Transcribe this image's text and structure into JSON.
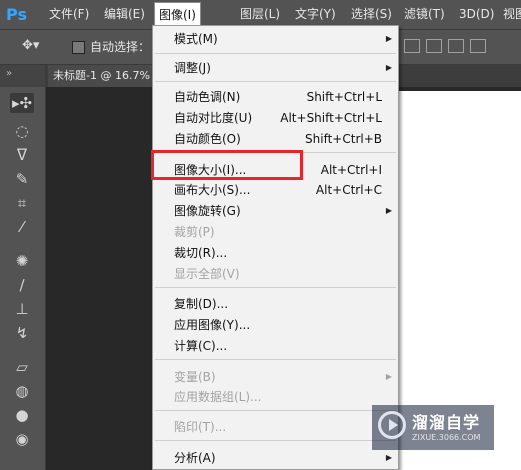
{
  "app": {
    "logo": "Ps"
  },
  "menubar": {
    "items": [
      {
        "label": "文件(F)"
      },
      {
        "label": "编辑(E)"
      },
      {
        "label": "图像(I)"
      },
      {
        "label": "图层(L)"
      },
      {
        "label": "文字(Y)"
      },
      {
        "label": "选择(S)"
      },
      {
        "label": "滤镜(T)"
      },
      {
        "label": "3D(D)"
      },
      {
        "label": "视图("
      }
    ]
  },
  "options_bar": {
    "auto_select_label": "自动选择：",
    "move_tool_icon": "move-icon"
  },
  "document_tab": {
    "title": "未标题-1 @ 16.7%"
  },
  "image_menu": {
    "items": [
      {
        "label": "模式(M)",
        "submenu": true
      },
      {
        "label": "调整(J)",
        "submenu": true
      },
      {
        "label": "自动色调(N)",
        "shortcut": "Shift+Ctrl+L"
      },
      {
        "label": "自动对比度(U)",
        "shortcut": "Alt+Shift+Ctrl+L"
      },
      {
        "label": "自动颜色(O)",
        "shortcut": "Shift+Ctrl+B"
      },
      {
        "label": "图像大小(I)...",
        "shortcut": "Alt+Ctrl+I"
      },
      {
        "label": "画布大小(S)...",
        "shortcut": "Alt+Ctrl+C"
      },
      {
        "label": "图像旋转(G)",
        "submenu": true
      },
      {
        "label": "裁剪(P)",
        "disabled": true
      },
      {
        "label": "裁切(R)..."
      },
      {
        "label": "显示全部(V)",
        "disabled": true
      },
      {
        "label": "复制(D)..."
      },
      {
        "label": "应用图像(Y)..."
      },
      {
        "label": "计算(C)..."
      },
      {
        "label": "变量(B)",
        "submenu": true,
        "disabled": true
      },
      {
        "label": "应用数据组(L)...",
        "disabled": true
      },
      {
        "label": "陷印(T)...",
        "disabled": true
      },
      {
        "label": "分析(A)",
        "submenu": true
      }
    ]
  },
  "watermark": {
    "title": "溜溜自学",
    "subtitle": "ZIXUE.3066.COM"
  },
  "colors": {
    "highlight": "#e8262a",
    "menubar": "#535353",
    "canvas": "#282828"
  }
}
